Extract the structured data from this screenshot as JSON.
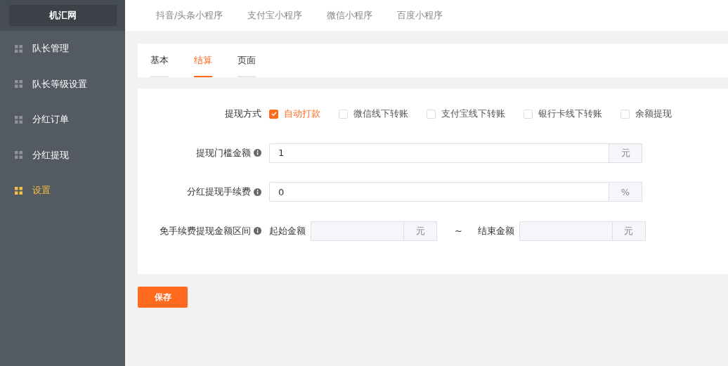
{
  "sidebar": {
    "logo": "机汇网",
    "items": [
      {
        "label": "队长管理",
        "selected": false
      },
      {
        "label": "队长等级设置",
        "selected": false
      },
      {
        "label": "分红订单",
        "selected": false
      },
      {
        "label": "分红提现",
        "selected": false
      },
      {
        "label": "设置",
        "selected": true
      }
    ]
  },
  "top_nav": [
    "抖音/头条小程序",
    "支付宝小程序",
    "微信小程序",
    "百度小程序"
  ],
  "tabs": [
    {
      "label": "基本",
      "selected": false
    },
    {
      "label": "结算",
      "selected": true
    },
    {
      "label": "页面",
      "selected": false
    }
  ],
  "form": {
    "withdraw_methods": {
      "label": "提现方式",
      "options": [
        {
          "label": "自动打款",
          "checked": true
        },
        {
          "label": "微信线下转账",
          "checked": false
        },
        {
          "label": "支付宝线下转账",
          "checked": false
        },
        {
          "label": "银行卡线下转账",
          "checked": false
        },
        {
          "label": "余额提现",
          "checked": false
        }
      ]
    },
    "threshold": {
      "label": "提现门槛金额",
      "value": "1",
      "unit": "元"
    },
    "fee": {
      "label": "分红提现手续费",
      "value": "0",
      "unit": "%"
    },
    "free_range": {
      "label": "免手续费提现金额区间",
      "start_label": "起始金额",
      "start_unit": "元",
      "separator": "~",
      "end_label": "结束金额",
      "end_unit": "元"
    }
  },
  "save_button": "保存"
}
